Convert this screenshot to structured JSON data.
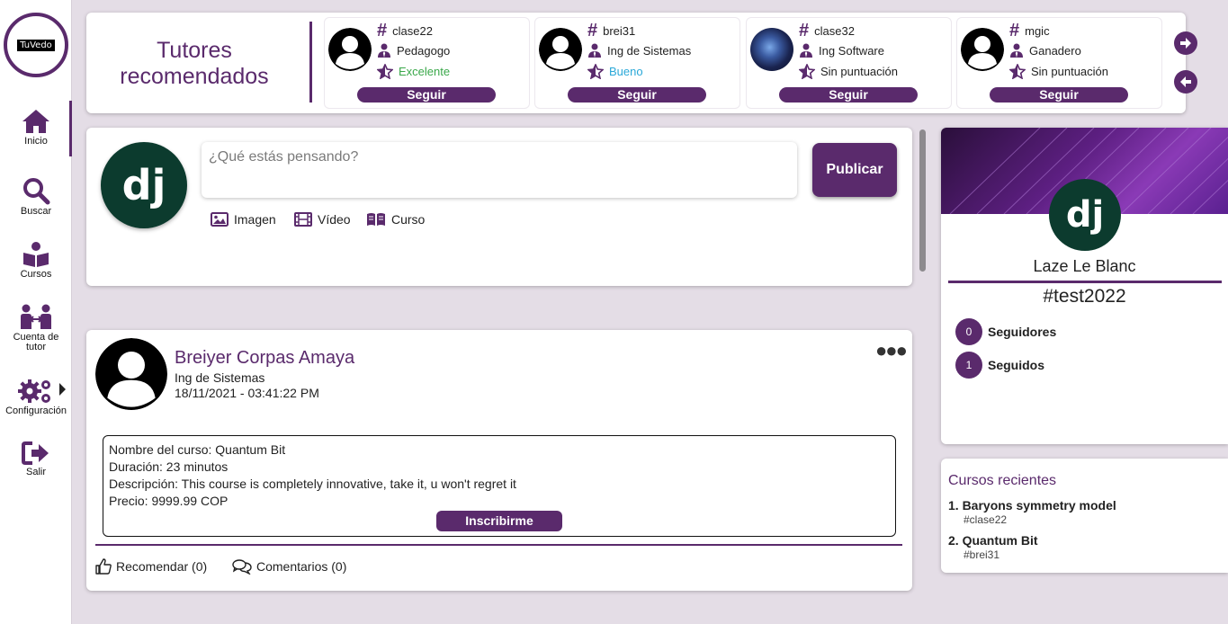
{
  "app": {
    "logo_text": "TuVedo"
  },
  "sidebar": {
    "items": [
      {
        "label": "Inicio",
        "icon": "home-icon"
      },
      {
        "label": "Buscar",
        "icon": "search-icon"
      },
      {
        "label": "Cursos",
        "icon": "book-reader-icon"
      },
      {
        "label": "Cuenta de tutor",
        "icon": "tutor-account-icon"
      },
      {
        "label": "Configuración",
        "icon": "gears-icon"
      },
      {
        "label": "Salir",
        "icon": "sign-out-icon"
      }
    ]
  },
  "tutors": {
    "title": "Tutores recomendados",
    "items": [
      {
        "username": "clase22",
        "role": "Pedagogo",
        "rating": "Excelente",
        "rating_color": "#3aa84a",
        "follow": "Seguir",
        "avatar": "default"
      },
      {
        "username": "brei31",
        "role": "Ing de Sistemas",
        "rating": "Bueno",
        "rating_color": "#2aa8d8",
        "follow": "Seguir",
        "avatar": "default"
      },
      {
        "username": "clase32",
        "role": "Ing Software",
        "rating": "Sin puntuación",
        "rating_color": "#222222",
        "follow": "Seguir",
        "avatar": "photo"
      },
      {
        "username": "mgic",
        "role": "Ganadero",
        "rating": "Sin puntuación",
        "rating_color": "#222222",
        "follow": "Seguir",
        "avatar": "default"
      }
    ]
  },
  "composer": {
    "avatar_text": "dj",
    "placeholder": "¿Qué estás pensando?",
    "publish": "Publicar",
    "attach": {
      "image": "Imagen",
      "video": "Vídeo",
      "course": "Curso"
    }
  },
  "post": {
    "author": "Breiyer Corpas Amaya",
    "role": "Ing de Sistemas",
    "date": "18/11/2021 - 03:41:22 PM",
    "course": {
      "name": "Nombre del curso: Quantum Bit",
      "duration": "Duración: 23 minutos",
      "description": "Descripción: This course is completely innovative, take it, u won't regret it",
      "price": "Precio: 9999.99 COP",
      "enroll": "Inscribirme"
    },
    "recommend": "Recomendar (0)",
    "comments": "Comentarios (0)"
  },
  "profile": {
    "avatar_text": "dj",
    "name": "Laze Le Blanc",
    "tag": "#test2022",
    "followers_count": "0",
    "followers_label": "Seguidores",
    "following_count": "1",
    "following_label": "Seguidos"
  },
  "recent": {
    "title": "Cursos recientes",
    "items": [
      {
        "name": "1. Baryons symmetry model",
        "tag": "#clase22"
      },
      {
        "name": "2. Quantum Bit",
        "tag": "#brei31"
      }
    ]
  },
  "colors": {
    "accent": "#5a2a6c",
    "background": "#e4dde6"
  }
}
